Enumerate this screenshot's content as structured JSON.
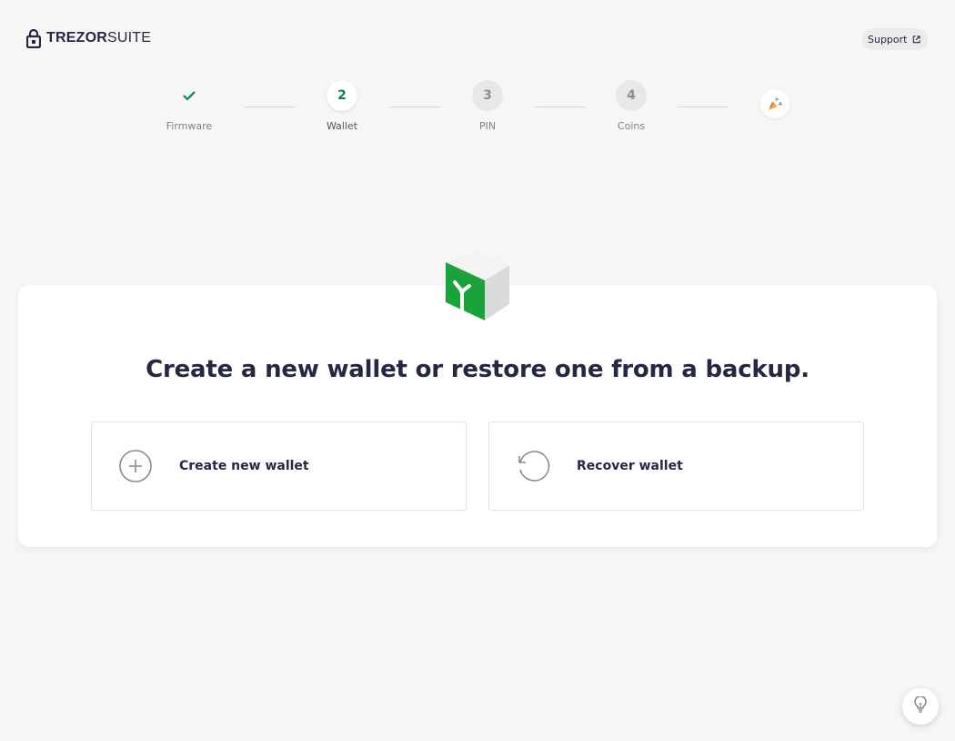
{
  "header": {
    "logo_bold": "TREZOR",
    "logo_light": "SUITE",
    "support_label": "Support"
  },
  "stepper": {
    "steps": [
      {
        "label": "Firmware",
        "number": "",
        "state": "done"
      },
      {
        "label": "Wallet",
        "number": "2",
        "state": "active"
      },
      {
        "label": "PIN",
        "number": "3",
        "state": "todo"
      },
      {
        "label": "Coins",
        "number": "4",
        "state": "todo"
      }
    ],
    "final_icon": "party-popper-icon"
  },
  "main": {
    "title": "Create a new wallet or restore one from a backup.",
    "options": [
      {
        "label": "Create new wallet",
        "icon": "plus-circle-icon"
      },
      {
        "label": "Recover wallet",
        "icon": "history-icon"
      }
    ]
  },
  "colors": {
    "accent": "#00854d",
    "device_green": "#1aa33a",
    "background": "#f6f6f6",
    "text": "#262742"
  }
}
